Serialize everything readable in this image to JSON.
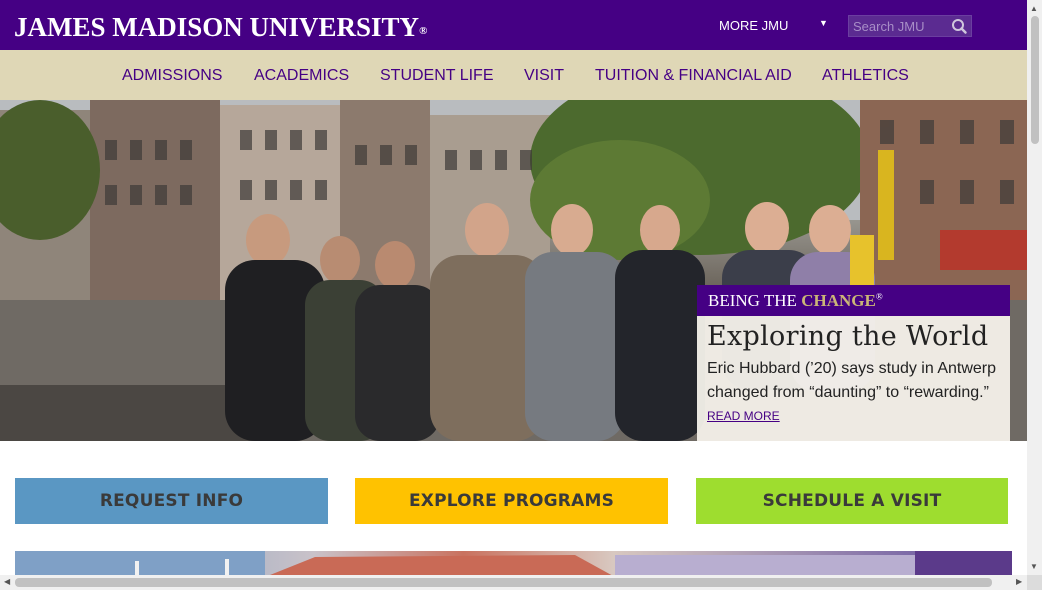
{
  "header": {
    "logo_text": "JAMES MADISON UNIVERSITY",
    "logo_mark": "®",
    "more_label": "MORE JMU",
    "more_caret": "▼",
    "search_placeholder": "Search JMU"
  },
  "nav": {
    "items": [
      {
        "label": "ADMISSIONS"
      },
      {
        "label": "ACADEMICS"
      },
      {
        "label": "STUDENT LIFE"
      },
      {
        "label": "VISIT"
      },
      {
        "label": "TUITION & FINANCIAL AID"
      },
      {
        "label": "ATHLETICS"
      }
    ]
  },
  "hero": {
    "band_prefix": "BEING THE ",
    "band_highlight": "CHANGE",
    "band_mark": "®",
    "title": "Exploring the World",
    "description": "Eric Hubbard (’20) says study in Antwerp changed from “daunting” to “rewarding.”",
    "read_more": "READ MORE"
  },
  "cta": {
    "request": "REQUEST INFO",
    "explore": "EXPLORE PROGRAMS",
    "visit": "SCHEDULE A VISIT"
  },
  "colors": {
    "purple": "#450084",
    "gold": "#cbb677",
    "nav_bg": "#dfd7b6",
    "request_bg": "#5a97c3",
    "explore_bg": "#ffc200",
    "visit_bg": "#9edd2f"
  }
}
